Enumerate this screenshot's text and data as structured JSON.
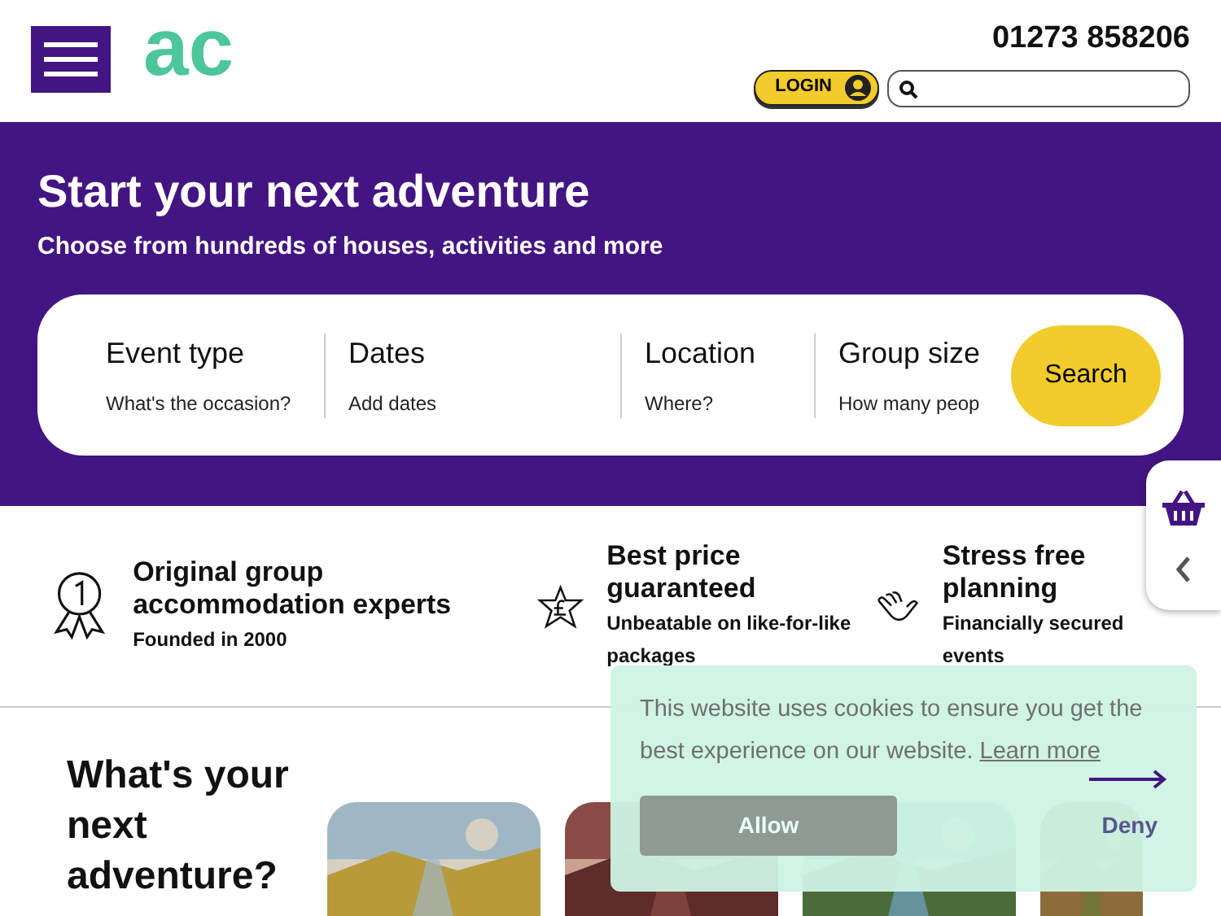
{
  "header": {
    "logo": "ac",
    "phone": "01273 858206",
    "login": "LOGIN"
  },
  "hero": {
    "title": "Start your next adventure",
    "subtitle": "Choose from hundreds of houses, activities and more",
    "fields": [
      {
        "label": "Event type",
        "placeholder": "What's the occasion?"
      },
      {
        "label": "Dates",
        "placeholder": "Add dates"
      },
      {
        "label": "Location",
        "placeholder": "Where?"
      },
      {
        "label": "Group size",
        "placeholder": "How many peop"
      }
    ],
    "search_button": "Search"
  },
  "features": [
    {
      "kind": "award",
      "title": "Original group accommodation experts",
      "text": "Founded in 2000"
    },
    {
      "kind": "price",
      "title": "Best price guaranteed",
      "text": "Unbeatable on like-for-like packages"
    },
    {
      "kind": "hand",
      "title": "Stress free planning",
      "text": "Financially secured events"
    }
  ],
  "adventure": {
    "title": "What's your next adventure?"
  },
  "cookie": {
    "message": "This website uses cookies to ensure you get the best experience on our website.",
    "link": "Learn more",
    "allow": "Allow",
    "deny": "Deny"
  }
}
